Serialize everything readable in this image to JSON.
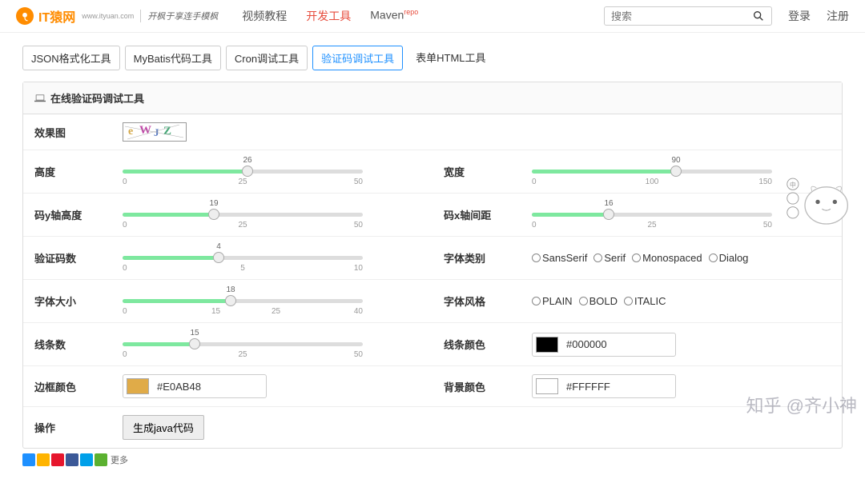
{
  "header": {
    "logo_text": "IT猿网",
    "logo_sub": "www.ityuan.com",
    "slogan": "开枫于享连手模枫",
    "nav": [
      {
        "label": "视频教程",
        "active": false
      },
      {
        "label": "开发工具",
        "active": true
      },
      {
        "label": "Maven",
        "sup": "repo",
        "active": false
      }
    ],
    "search_placeholder": "搜索",
    "login": "登录",
    "register": "注册"
  },
  "tabs": [
    {
      "label": "JSON格式化工具",
      "active": false
    },
    {
      "label": "MyBatis代码工具",
      "active": false
    },
    {
      "label": "Cron调试工具",
      "active": false
    },
    {
      "label": "验证码调试工具",
      "active": true
    },
    {
      "label": "表单HTML工具",
      "active": false,
      "plain": true
    }
  ],
  "panel_title": "在线验证码调试工具",
  "captcha_text": "eWJZ",
  "rows": {
    "effect": {
      "label": "效果图"
    },
    "height": {
      "label": "高度",
      "value": 26,
      "min": 0,
      "mid": 25,
      "max": 50
    },
    "width": {
      "label": "宽度",
      "value": 90,
      "min": 0,
      "mid": 100,
      "max": 150
    },
    "codeY": {
      "label": "码y轴高度",
      "value": 19,
      "min": 0,
      "mid": 25,
      "max": 50
    },
    "codeX": {
      "label": "码x轴间距",
      "value": 16,
      "min": 0,
      "mid": 25,
      "max": 50
    },
    "codeCount": {
      "label": "验证码数",
      "value": 4,
      "min": 0,
      "mid": 5,
      "max": 10
    },
    "fontFamily": {
      "label": "字体类别",
      "options": [
        "SansSerif",
        "Serif",
        "Monospaced",
        "Dialog"
      ]
    },
    "fontSize": {
      "label": "字体大小",
      "value": 18,
      "min": 0,
      "q1": 15,
      "mid": 25,
      "max": 40
    },
    "fontStyle": {
      "label": "字体风格",
      "options": [
        "PLAIN",
        "BOLD",
        "ITALIC"
      ]
    },
    "lineCount": {
      "label": "线条数",
      "value": 15,
      "min": 0,
      "mid": 25,
      "max": 50
    },
    "lineColor": {
      "label": "线条颜色",
      "value": "#000000"
    },
    "borderColor": {
      "label": "边框颜色",
      "value": "#E0AB48"
    },
    "bgColor": {
      "label": "背景颜色",
      "value": "#FFFFFF"
    },
    "action": {
      "label": "操作",
      "button": "生成java代码"
    }
  },
  "share_more": "更多",
  "watermark": "知乎 @齐小神"
}
